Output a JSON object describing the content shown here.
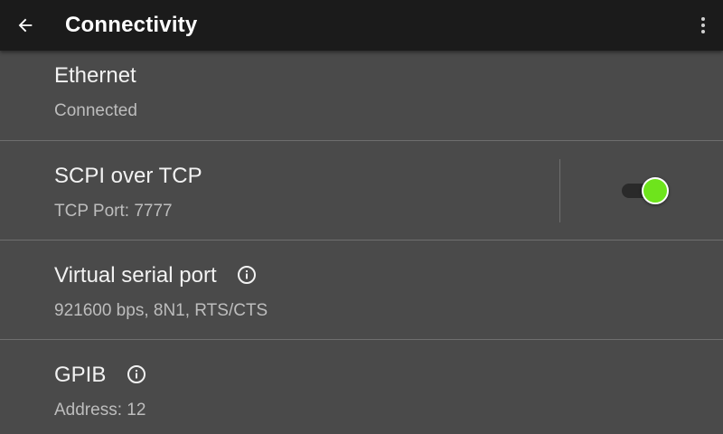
{
  "header": {
    "title": "Connectivity",
    "back_icon": "arrow-left-icon",
    "menu_icon": "more-vertical-icon"
  },
  "items": [
    {
      "title": "Ethernet",
      "subtitle": "Connected"
    },
    {
      "title": "SCPI over TCP",
      "subtitle": "TCP Port: 7777",
      "toggle_on": true
    },
    {
      "title": "Virtual serial port",
      "subtitle": "921600 bps, 8N1, RTS/CTS",
      "icon": "info-icon"
    },
    {
      "title": "GPIB",
      "subtitle": "Address: 12",
      "icon": "info-icon"
    }
  ],
  "colors": {
    "topbar": "#1b1b1b",
    "background": "#4a4a4a",
    "toggle_on": "#6ee41c"
  }
}
